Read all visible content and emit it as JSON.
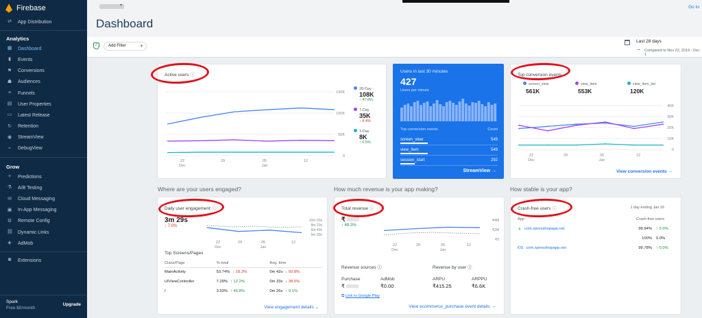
{
  "sidebar": {
    "brand": "Firebase",
    "top_item": "App Distribution",
    "analytics_header": "Analytics",
    "analytics_items": [
      "Dashboard",
      "Events",
      "Conversions",
      "Audiences",
      "Funnels",
      "User Properties",
      "Latest Release",
      "Retention",
      "StreamView",
      "DebugView"
    ],
    "grow_header": "Grow",
    "grow_items": [
      "Predictions",
      "A/B Testing",
      "Cloud Messaging",
      "In-App Messaging",
      "Remote Config",
      "Dynamic Links",
      "AdMob"
    ],
    "extensions": "Extensions",
    "plan_name": "Spark",
    "plan_price": "Free $0/month",
    "upgrade": "Upgrade"
  },
  "header": {
    "title": "Dashboard",
    "goto": "Go to"
  },
  "filter": {
    "add_filter": "Add Filter",
    "date_range": "Last 28 days",
    "compare": "Compared to Nov 22, 2019 - Dec 1"
  },
  "active_users": {
    "title": "Active users",
    "y_ticks": [
      "150K",
      "100K",
      "50K",
      "0"
    ],
    "x_ticks": [
      {
        "d": "22",
        "m": "Dec"
      },
      {
        "d": "29",
        "m": ""
      },
      {
        "d": "05",
        "m": "Jan"
      },
      {
        "d": "12",
        "m": ""
      }
    ],
    "legend": [
      {
        "name": "28-Day",
        "value": "108K",
        "delta": "↑ 47.8%",
        "dir": "up",
        "color": "#4285f4"
      },
      {
        "name": "7-Day",
        "value": "35K",
        "delta": "↓ 8.4%",
        "dir": "dn",
        "color": "#a142f4"
      },
      {
        "name": "1-Day",
        "value": "8K",
        "delta": "↑ 0.5%",
        "dir": "up",
        "color": "#12b5cb"
      }
    ]
  },
  "realtime": {
    "title": "Users in last 30 minutes",
    "value": "427",
    "sub": "Users per minute",
    "col_event": "Top conversion events",
    "col_count": "Count",
    "rows": [
      {
        "name": "screen_view",
        "count": "549"
      },
      {
        "name": "view_item",
        "count": "549"
      },
      {
        "name": "session_start",
        "count": "292"
      }
    ],
    "link": "StreamView"
  },
  "conversions": {
    "title": "Top conversion events",
    "legend": [
      {
        "name": "screen_view",
        "value": "561K",
        "color": "#4285f4"
      },
      {
        "name": "view_item",
        "value": "553K",
        "color": "#a142f4"
      },
      {
        "name": "view_item_list",
        "value": "120K",
        "color": "#12b5cb"
      }
    ],
    "y_ticks": [
      "40K",
      "30K",
      "20K",
      "10K",
      "0"
    ],
    "x_ticks": [
      {
        "d": "22",
        "m": "Dec"
      },
      {
        "d": "29",
        "m": ""
      },
      {
        "d": "05",
        "m": "Jan"
      },
      {
        "d": "12",
        "m": ""
      }
    ],
    "link": "View conversion events"
  },
  "sections": {
    "engaged": "Where are your users engaged?",
    "revenue": "How much revenue is your app making?",
    "stable": "How stable is your app?"
  },
  "engagement": {
    "title": "Daily user engagement",
    "value": "3m 29s",
    "delta": "↓ 7.0%",
    "right_ticks": [
      "10m 00s",
      "8m 20s",
      "6m 40s",
      "5m 00s"
    ],
    "x_ticks": [
      {
        "d": "22",
        "m": "Dec"
      },
      {
        "d": "29",
        "m": ""
      },
      {
        "d": "05",
        "m": "Jan"
      },
      {
        "d": "12",
        "m": ""
      }
    ],
    "table_title": "Top Screens/Pages",
    "headers": [
      "Class/Page",
      "% total",
      "Avg. time"
    ],
    "rows": [
      {
        "page": "MainActivity",
        "pct": "53.74%",
        "pct_d": "↓ 18.3%",
        "pct_dir": "dn",
        "time": "0m 42s",
        "time_d": "↓ 50.8%",
        "time_dir": "dn"
      },
      {
        "page": "UIViewController",
        "pct": "7.29%",
        "pct_d": "↑ 12.2%",
        "pct_dir": "up",
        "time": "0m 33s",
        "time_d": "↓ 38.5%",
        "time_dir": "dn"
      },
      {
        "page": "/",
        "pct": "3.53%",
        "pct_d": "↑ 46.8%",
        "pct_dir": "up",
        "time": "0m 26s",
        "time_d": "↑ 0.1%",
        "time_dir": "up"
      }
    ],
    "link": "View engagement details"
  },
  "revenue": {
    "title": "Total revenue",
    "value": "₹",
    "delta": "↑ 69.3%",
    "right_ticks": [
      "₹4M",
      "₹2M",
      "₹0"
    ],
    "x_ticks": [
      {
        "d": "22",
        "m": "Dec"
      },
      {
        "d": "29",
        "m": ""
      },
      {
        "d": "05",
        "m": "Jan"
      },
      {
        "d": "12",
        "m": ""
      }
    ],
    "sources_title": "Revenue sources",
    "by_user_title": "Revenue by user",
    "purchase_label": "Purchase",
    "purchase_value": "₹",
    "admob_label": "AdMob",
    "admob_value": "₹0.00",
    "arpu_label": "ARPU",
    "arpu_value": "₹415.25",
    "arppu_label": "ARPPU",
    "arppu_value": "₹6.6K",
    "gplay": "Link to Google Play",
    "link": "View ecommerce_purchase event details"
  },
  "crash": {
    "title": "Crash-free users",
    "period": "1 day ending Jan 16",
    "col_app": "App",
    "col_users": "Crash-free users",
    "rows": [
      {
        "platform": "android",
        "app": "com.xpresshopapp.net",
        "pct": "99.94%",
        "delta": "↑ 0.0%",
        "dir": "up"
      },
      {
        "platform": "",
        "app": "",
        "pct": "100%",
        "delta": "0.0%",
        "dir": "none"
      },
      {
        "platform": "ios",
        "app": "com.xpresshopapp.net",
        "pct": "99.78%",
        "delta": "↑ 0.0%",
        "dir": "up"
      }
    ]
  },
  "chart_data": [
    {
      "type": "line",
      "title": "Active users",
      "x": [
        "Dec 18",
        "Dec 22",
        "Dec 29",
        "Jan 05",
        "Jan 12",
        "Jan 16"
      ],
      "series": [
        {
          "name": "28-Day",
          "values": [
            74000,
            90000,
            103000,
            108000,
            112000,
            108000
          ]
        },
        {
          "name": "7-Day",
          "values": [
            34000,
            35000,
            37000,
            34000,
            36000,
            35000
          ]
        },
        {
          "name": "1-Day",
          "values": [
            7000,
            8000,
            8000,
            8000,
            8000,
            8000
          ]
        }
      ],
      "ylim": [
        0,
        150000
      ]
    },
    {
      "type": "line",
      "title": "Top conversion events",
      "x": [
        "Dec 18",
        "Dec 22",
        "Dec 29",
        "Jan 05",
        "Jan 12",
        "Jan 16"
      ],
      "series": [
        {
          "name": "screen_view",
          "values": [
            19000,
            21000,
            23000,
            24000,
            21000,
            25000
          ]
        },
        {
          "name": "view_item",
          "values": [
            22000,
            17000,
            22000,
            25000,
            19000,
            23000
          ]
        },
        {
          "name": "view_item_list",
          "values": [
            4000,
            4000,
            4000,
            5000,
            4000,
            4000
          ]
        }
      ],
      "ylim": [
        0,
        40000
      ]
    },
    {
      "type": "line",
      "title": "Daily user engagement",
      "x": [
        "Dec 22",
        "Dec 29",
        "Jan 05",
        "Jan 12"
      ],
      "series": [
        {
          "name": "current",
          "values": [
            330,
            300,
            310,
            290
          ]
        }
      ]
    },
    {
      "type": "line",
      "title": "Total revenue",
      "x": [
        "Dec 22",
        "Dec 29",
        "Jan 05",
        "Jan 12"
      ],
      "series": [
        {
          "name": "current",
          "values": [
            1800000,
            2200000,
            2500000,
            2400000
          ]
        }
      ],
      "ylim": [
        0,
        4000000
      ]
    }
  ]
}
